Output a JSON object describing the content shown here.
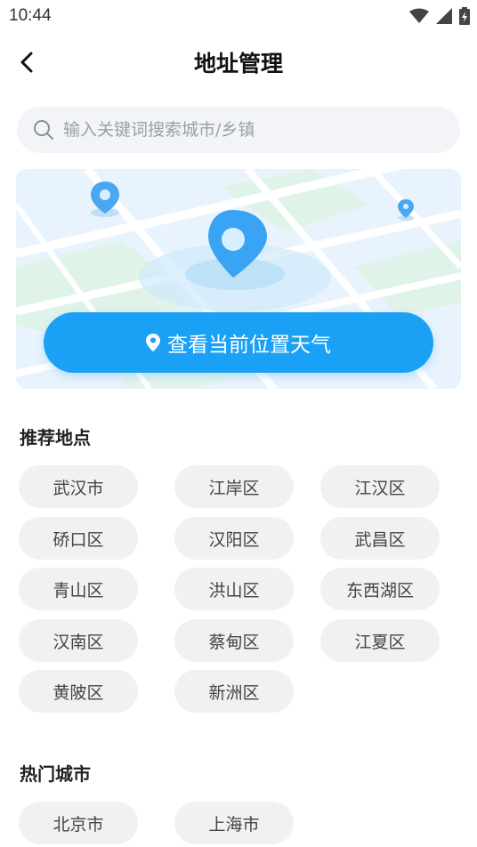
{
  "status_bar": {
    "time": "10:44"
  },
  "header": {
    "title": "地址管理"
  },
  "search": {
    "placeholder": "输入关键词搜索城市/乡镇"
  },
  "map_card": {
    "locate_label": "查看当前位置天气"
  },
  "recommended": {
    "title": "推荐地点",
    "items": [
      "武汉市",
      "江岸区",
      "江汉区",
      "硚口区",
      "汉阳区",
      "武昌区",
      "青山区",
      "洪山区",
      "东西湖区",
      "汉南区",
      "蔡甸区",
      "江夏区",
      "黄陂区",
      "新洲区"
    ]
  },
  "hot_cities": {
    "title": "热门城市",
    "items": [
      "北京市",
      "上海市"
    ]
  },
  "colors": {
    "accent": "#1aa0f5",
    "chip_bg": "#f1f1f1",
    "search_bg": "#f2f4f8"
  }
}
